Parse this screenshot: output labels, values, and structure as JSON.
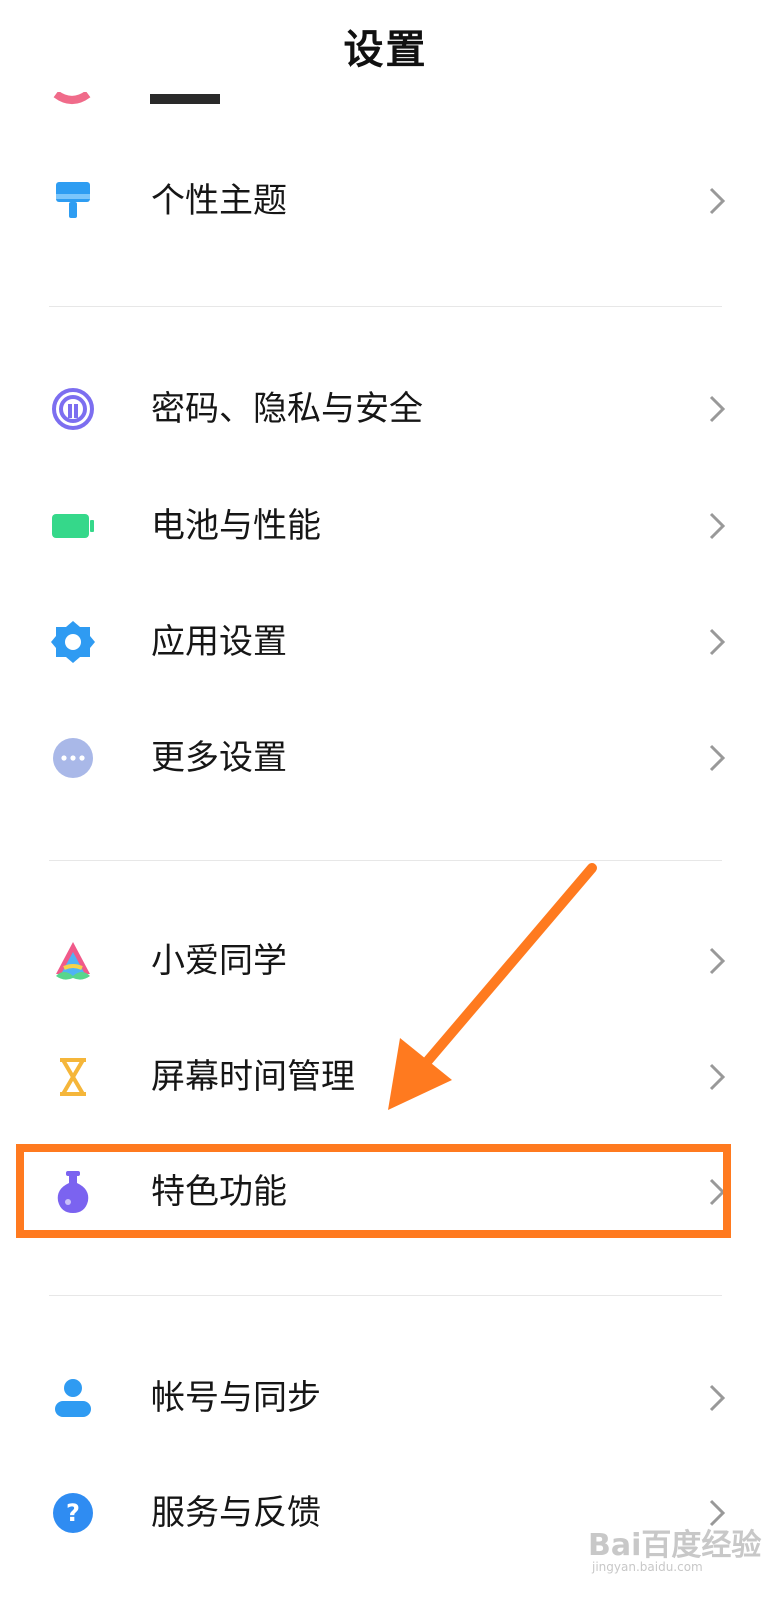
{
  "header": {
    "title": "设置"
  },
  "items": [
    {
      "label": "个性主题",
      "icon": "paint-roller-icon",
      "color": "#2e9df2"
    },
    {
      "label": "密码、隐私与安全",
      "icon": "fingerprint-icon",
      "color": "#7c6ef0"
    },
    {
      "label": "电池与性能",
      "icon": "battery-icon",
      "color": "#35d88a"
    },
    {
      "label": "应用设置",
      "icon": "gear-icon",
      "color": "#2f9bf2"
    },
    {
      "label": "更多设置",
      "icon": "more-dots-icon",
      "color": "#a9b8e8"
    },
    {
      "label": "小爱同学",
      "icon": "xiaoai-icon",
      "color": "#f05a8a"
    },
    {
      "label": "屏幕时间管理",
      "icon": "hourglass-icon",
      "color": "#f5b63a"
    },
    {
      "label": "特色功能",
      "icon": "flask-icon",
      "color": "#7b63f0"
    },
    {
      "label": "帐号与同步",
      "icon": "account-icon",
      "color": "#2f9bf2"
    },
    {
      "label": "服务与反馈",
      "icon": "help-icon",
      "color": "#2f8cf2"
    }
  ],
  "annotation": {
    "highlight_color": "#ff7a1f"
  },
  "watermark": {
    "line1": "Bai百度经验",
    "line2": "jingyan.baidu.com"
  }
}
